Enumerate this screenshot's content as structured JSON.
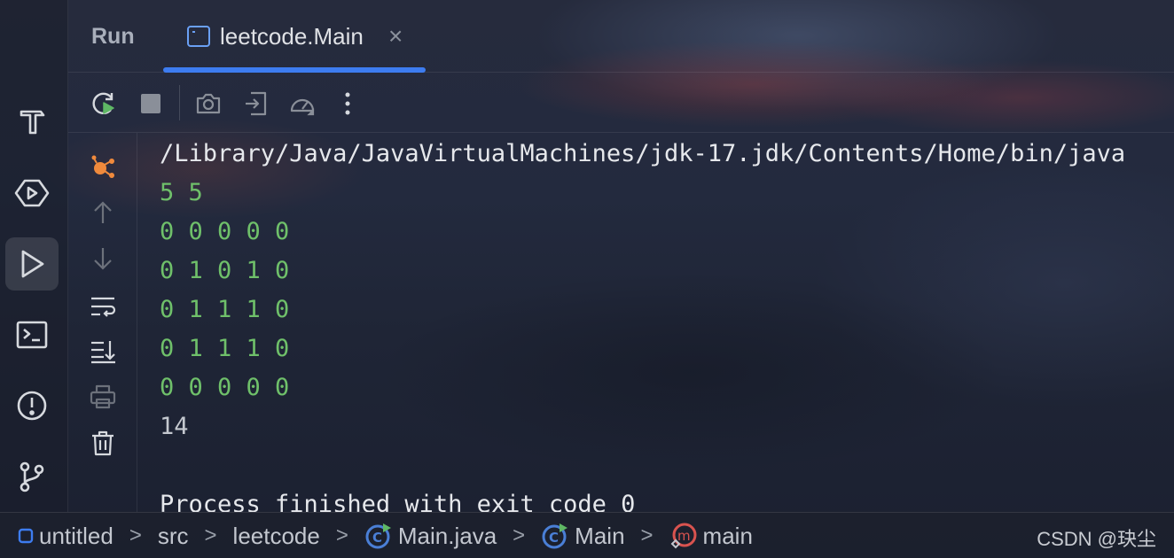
{
  "header": {
    "panel_title": "Run",
    "active_tab": {
      "label": "leetcode.Main",
      "close": "×"
    }
  },
  "toolbar": {
    "buttons": [
      "rerun-icon",
      "stop-icon",
      "camera-icon",
      "exit-icon",
      "gauge-icon",
      "more-icon"
    ]
  },
  "left_sidebar": {
    "items": [
      "build-hammer-icon",
      "services-icon",
      "run-icon",
      "terminal-icon",
      "problems-icon",
      "git-branch-icon"
    ],
    "active": "run-icon"
  },
  "gutter": {
    "buttons": [
      "debug-dot-icon",
      "arrow-up-icon",
      "arrow-down-icon",
      "soft-wrap-icon",
      "scroll-to-end-icon",
      "print-icon",
      "trash-icon"
    ]
  },
  "console": {
    "lines": [
      "/Library/Java/JavaVirtualMachines/jdk-17.jdk/Contents/Home/bin/java",
      "5 5",
      "0 0 0 0 0",
      "0 1 0 1 0",
      "0 1 1 1 0",
      "0 1 1 1 0",
      "0 0 0 0 0",
      "14",
      "",
      "Process finished with exit code 0"
    ]
  },
  "breadcrumbs": {
    "items": [
      "untitled",
      "src",
      "leetcode",
      "Main.java",
      "Main",
      "main"
    ],
    "separator": ">"
  },
  "watermark": "CSDN @玦尘",
  "colors": {
    "accent": "#3d7cf0",
    "input_green": "#6fc06a",
    "debug_orange": "#f08a3c",
    "run_green": "#5fb865"
  }
}
